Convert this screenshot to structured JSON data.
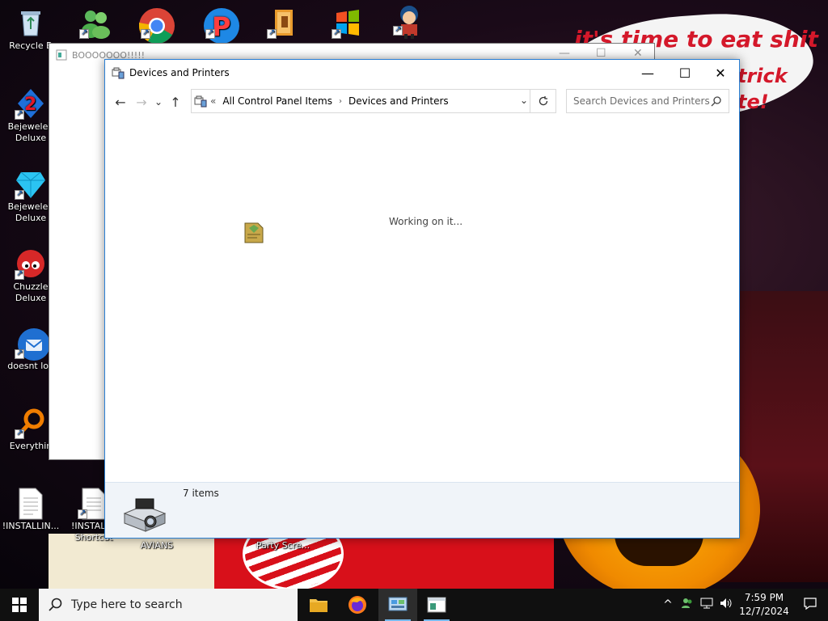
{
  "desktop": {
    "wallpaper_text": [
      "it's time to eat shit",
      "trick",
      "te!"
    ],
    "icons": [
      {
        "label": "Recycle B",
        "icon": "recycle-bin-icon"
      },
      {
        "label": "",
        "icon": "messenger-icon"
      },
      {
        "label": "",
        "icon": "chrome-icon"
      },
      {
        "label": "",
        "icon": "p-app-icon"
      },
      {
        "label": "",
        "icon": "folder-app-icon"
      },
      {
        "label": "",
        "icon": "windows-logo-icon"
      },
      {
        "label": "",
        "icon": "character-game-icon"
      },
      {
        "label": "Bejeweled Deluxe",
        "icon": "bejeweled-2-icon"
      },
      {
        "label": "Bejeweled Deluxe",
        "icon": "bejeweled-gem-icon"
      },
      {
        "label": "Chuzzle Deluxe",
        "icon": "chuzzle-icon"
      },
      {
        "label": "doesnt loa",
        "icon": "thunderbird-icon"
      },
      {
        "label": "Everythin",
        "icon": "everything-search-icon"
      },
      {
        "label": "!INSTALLIN...",
        "icon": "text-file-icon"
      },
      {
        "label": "!INSTALL - Shortcut",
        "icon": "text-file-shortcut-icon"
      },
      {
        "label": "AVIANS",
        "icon": "avians-icon"
      },
      {
        "label": "Party Scre...",
        "icon": "party-icon"
      }
    ]
  },
  "background_window": {
    "title": "BOOOOOOO!!!!!"
  },
  "window": {
    "title": "Devices and Printers",
    "controls": {
      "minimize": "—",
      "maximize": "☐",
      "close": "✕"
    },
    "nav": {
      "back": "←",
      "forward": "→",
      "recent": "⌄",
      "up": "↑"
    },
    "address": {
      "overflow": "«",
      "crumbs": [
        "All Control Panel Items",
        "Devices and Printers"
      ],
      "separator": "›"
    },
    "search_placeholder": "Search Devices and Printers",
    "status": "Working on it...",
    "details": {
      "items_count": "7 items"
    }
  },
  "taskbar": {
    "search_placeholder": "Type here to search",
    "apps": [
      {
        "name": "file-explorer",
        "icon": "folder-icon",
        "active": false
      },
      {
        "name": "firefox",
        "icon": "firefox-icon",
        "active": false
      },
      {
        "name": "control-panel",
        "icon": "control-panel-icon",
        "active": true
      },
      {
        "name": "window-app",
        "icon": "window-app-icon",
        "active": false
      }
    ],
    "tray": {
      "chevron": "^",
      "time": "7:59 PM",
      "date": "12/7/2024"
    }
  },
  "colors": {
    "accent": "#2a7fd4",
    "taskbar": "#101010",
    "details_pane": "#f0f4f9"
  }
}
